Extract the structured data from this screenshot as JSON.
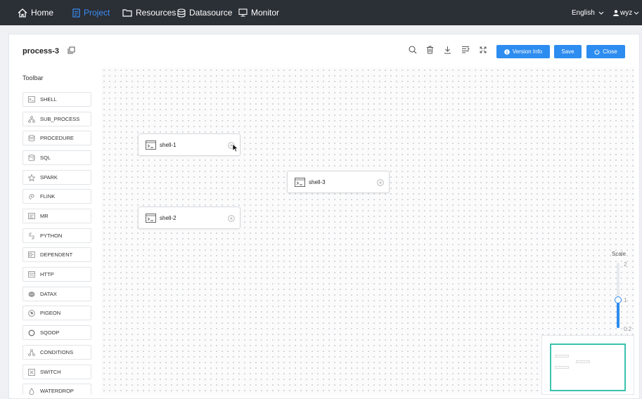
{
  "nav": {
    "home": "Home",
    "project": "Project",
    "resources": "Resources",
    "datasource": "Datasource",
    "monitor": "Monitor",
    "language": "English",
    "user": "wyz"
  },
  "header": {
    "process_name": "process-3",
    "version_info": "Version Info",
    "save": "Save",
    "close": "Close"
  },
  "toolbar": {
    "title": "Toolbar",
    "items": [
      "SHELL",
      "SUB_PROCESS",
      "PROCEDURE",
      "SQL",
      "SPARK",
      "FLINK",
      "MR",
      "PYTHON",
      "DEPENDENT",
      "HTTP",
      "DATAX",
      "PIGEON",
      "SQOOP",
      "CONDITIONS",
      "SWITCH",
      "WATERDROP"
    ]
  },
  "nodes": [
    "shell-1",
    "shell-3",
    "shell-2"
  ],
  "scale": {
    "label": "Scale",
    "max": "2",
    "current": "1",
    "min": "0.2",
    "value": 1
  },
  "colors": {
    "nav_bg": "#2b2f36",
    "accent": "#2d8cf0",
    "active_nav": "#3a8ef6",
    "minimap_border": "#3ac2b0"
  }
}
